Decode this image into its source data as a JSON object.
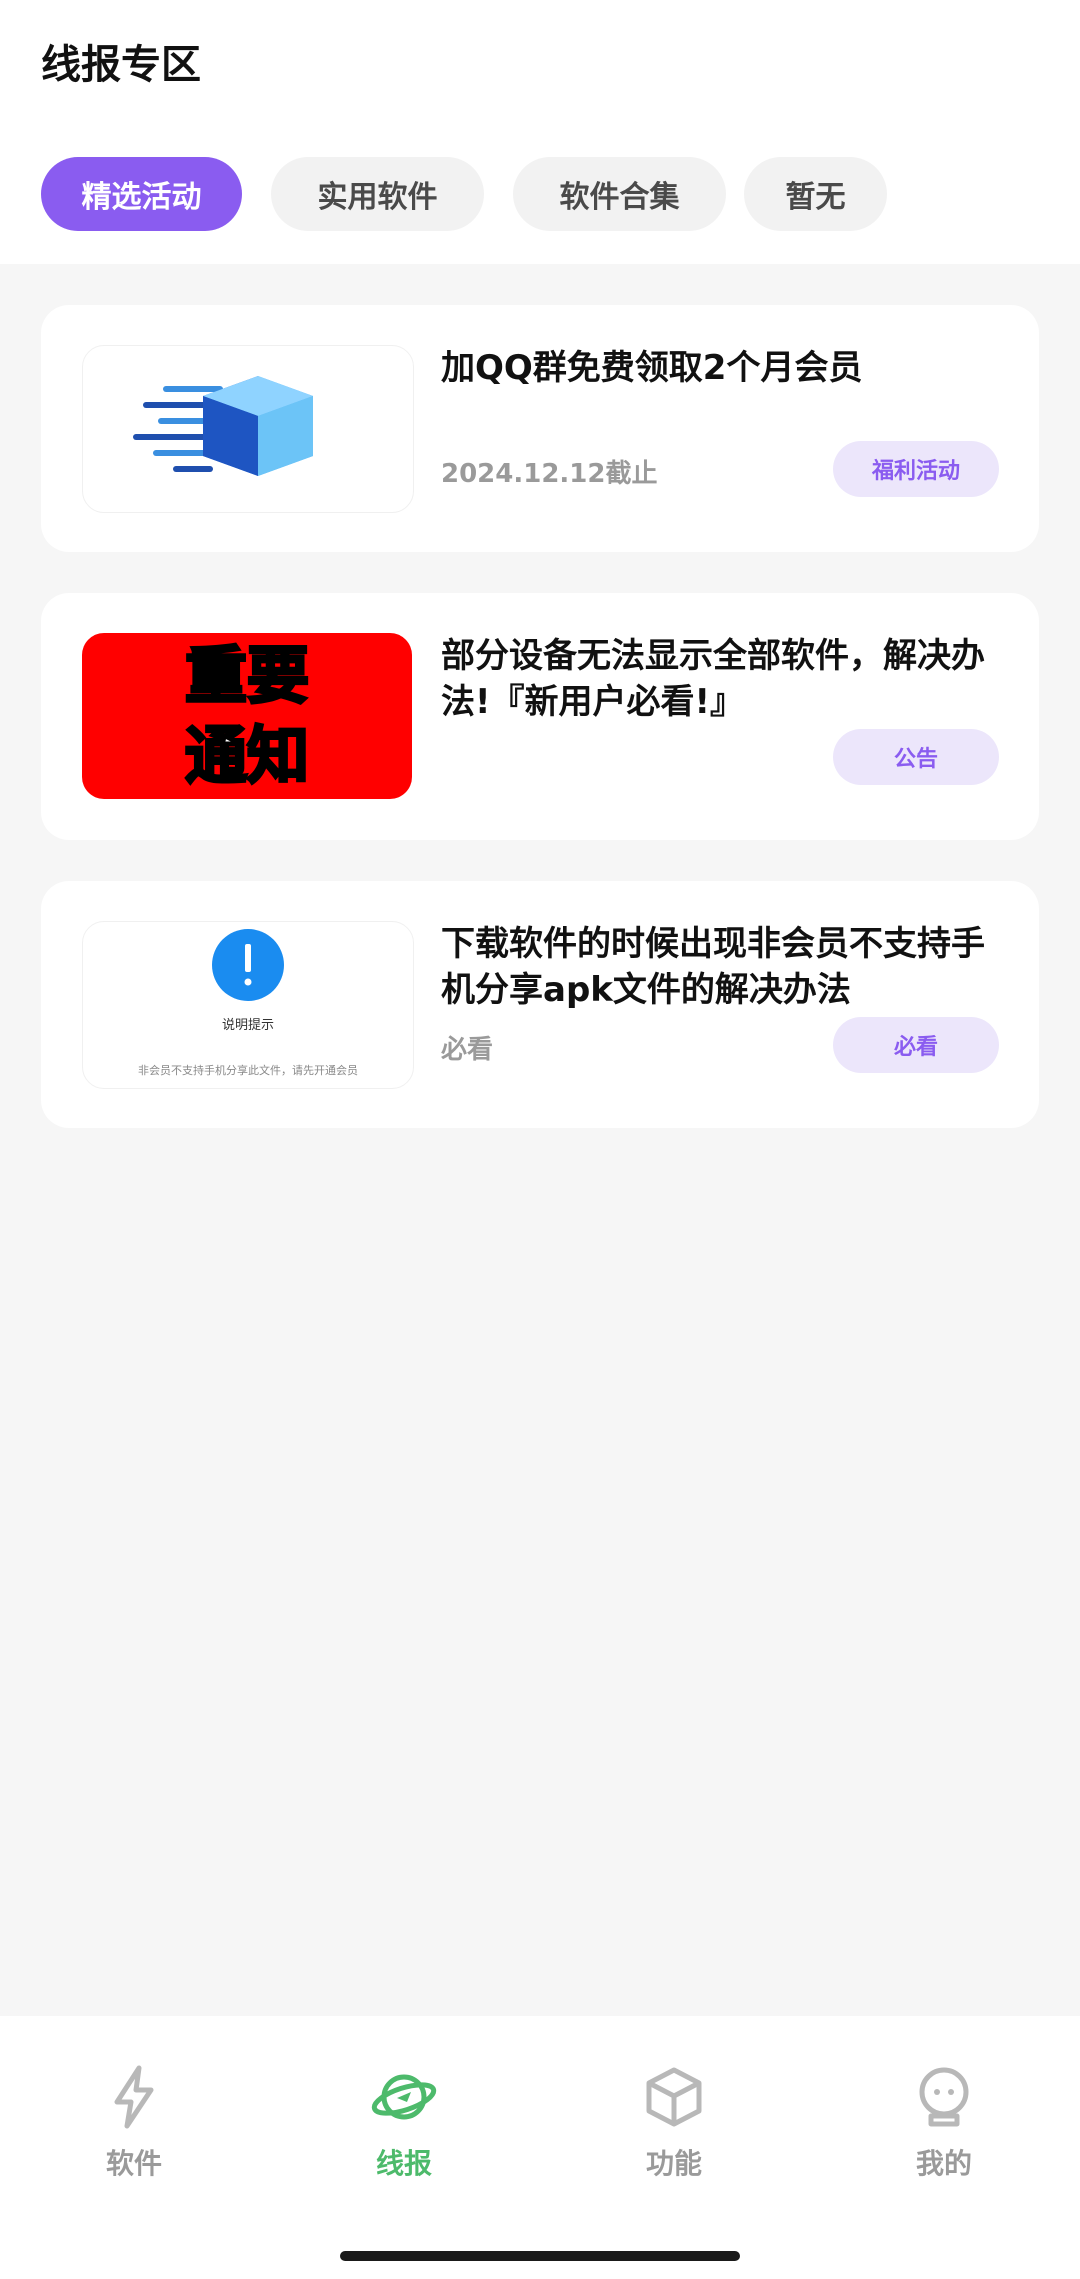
{
  "header": {
    "title": "线报专区",
    "tabs": [
      {
        "label": "精选活动",
        "active": true
      },
      {
        "label": "实用软件",
        "active": false
      },
      {
        "label": "软件合集",
        "active": false
      },
      {
        "label": "暂无",
        "active": false
      }
    ]
  },
  "cards": [
    {
      "title": "加QQ群免费领取2个月会员",
      "meta": "2024.12.12截止",
      "badge": "福利活动",
      "thumb_icon": "blue-cube-icon"
    },
    {
      "title": "部分设备无法显示全部软件，解决办法!『新用户必看!』",
      "meta": "",
      "badge": "公告",
      "thumb_text_line1": "重要",
      "thumb_text_line2": "通知",
      "thumb_bg": "#ff0000"
    },
    {
      "title": "下载软件的时候出现非会员不支持手机分享apk文件的解决办法",
      "meta": "必看",
      "badge": "必看",
      "thumb_icon": "exclamation-circle-icon",
      "thumb_caption": "说明提示",
      "thumb_footer": "非会员不支持手机分享此文件，请先开通会员"
    }
  ],
  "bottom_nav": [
    {
      "label": "软件",
      "icon": "lightning-icon",
      "active": false
    },
    {
      "label": "线报",
      "icon": "planet-icon",
      "active": true
    },
    {
      "label": "功能",
      "icon": "cube-icon",
      "active": false
    },
    {
      "label": "我的",
      "icon": "robot-face-icon",
      "active": false
    }
  ],
  "colors": {
    "accent": "#8a5cf0",
    "accent_light": "#ece6fb",
    "nav_active": "#4dba6b",
    "background": "#f6f6f6"
  }
}
